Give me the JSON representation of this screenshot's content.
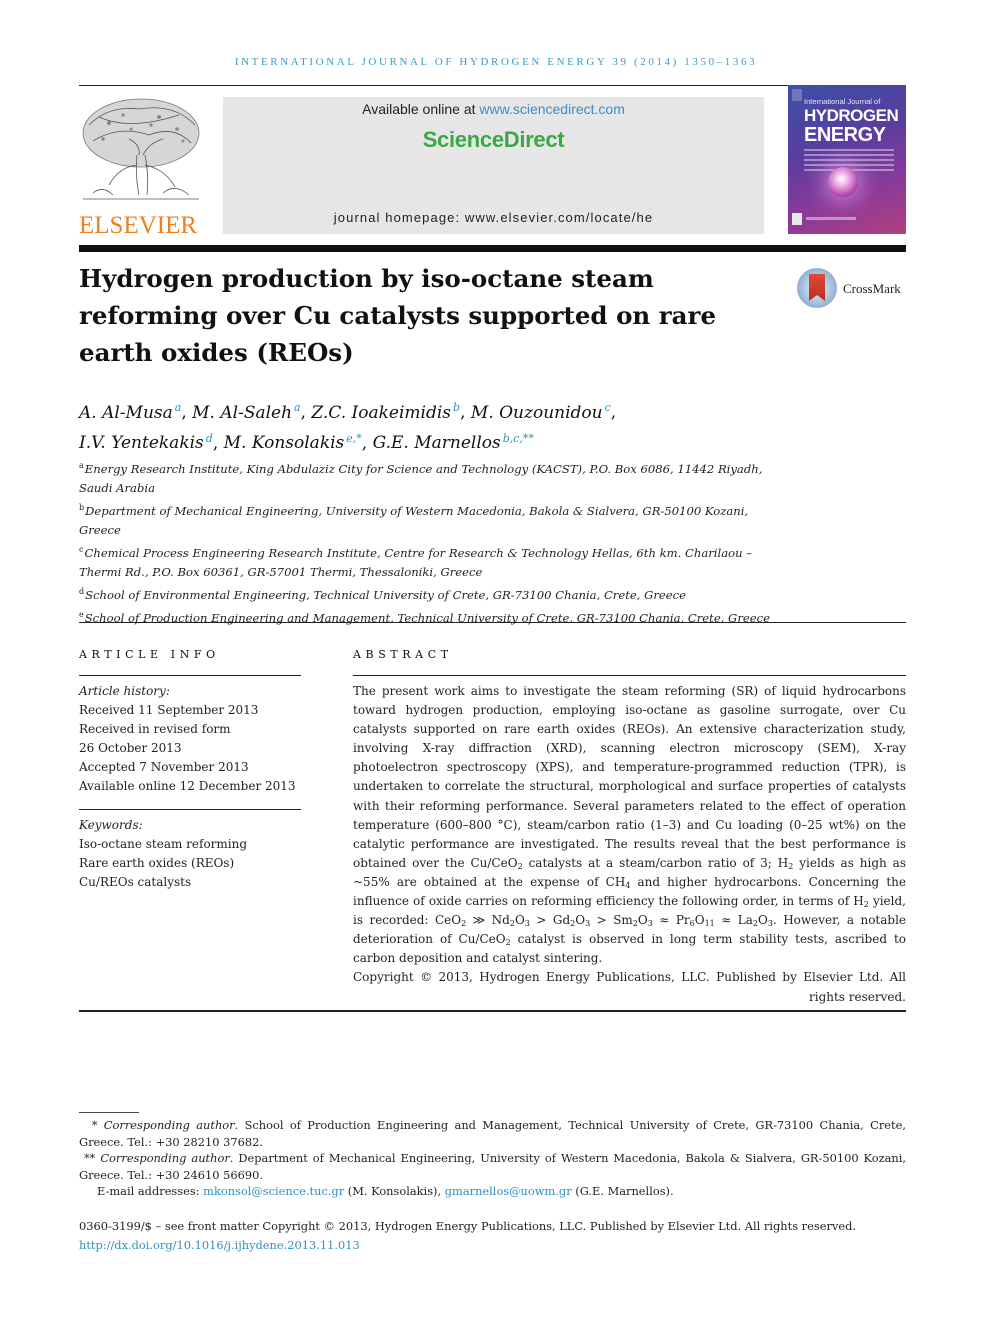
{
  "running_head": "International Journal of Hydrogen Energy 39 (2014) 1350–1363",
  "publisher": {
    "logo_icon": "elsevier-tree-icon",
    "name": "ELSEVIER"
  },
  "masthead": {
    "available_prefix": "Available online at ",
    "available_link": "www.sciencedirect.com",
    "brand": "ScienceDirect",
    "homepage": "journal homepage: www.elsevier.com/locate/he"
  },
  "cover": {
    "line1": "International Journal of",
    "line2": "HYDROGEN",
    "line3": "ENERGY"
  },
  "article": {
    "title": "Hydrogen production by iso-octane steam reforming over Cu catalysts supported on rare earth oxides (REOs)",
    "crossmark_label": "CrossMark",
    "authors": [
      {
        "name": "A. Al-Musa",
        "aff": "a",
        "sep": ", "
      },
      {
        "name": "M. Al-Saleh",
        "aff": "a",
        "sep": ", "
      },
      {
        "name": "Z.C. Ioakeimidis",
        "aff": "b",
        "sep": ", "
      },
      {
        "name": "M. Ouzounidou",
        "aff": "c",
        "sep": ","
      },
      {
        "name": "I.V. Yentekakis",
        "aff": "d",
        "sep": ", "
      },
      {
        "name": "M. Konsolakis",
        "aff": "e,*",
        "sep": ", "
      },
      {
        "name": "G.E. Marnellos",
        "aff": "b,c,**",
        "sep": ""
      }
    ],
    "affiliations": [
      {
        "key": "a",
        "text": "Energy Research Institute, King Abdulaziz City for Science and Technology (KACST), P.O. Box 6086, 11442 Riyadh, Saudi Arabia"
      },
      {
        "key": "b",
        "text": "Department of Mechanical Engineering, University of Western Macedonia, Bakola & Sialvera, GR-50100 Kozani, Greece"
      },
      {
        "key": "c",
        "text": "Chemical Process Engineering Research Institute, Centre for Research & Technology Hellas, 6th km. Charilaou – Thermi Rd., P.O. Box 60361, GR-57001 Thermi, Thessaloniki, Greece"
      },
      {
        "key": "d",
        "text": "School of Environmental Engineering, Technical University of Crete, GR-73100 Chania, Crete, Greece"
      },
      {
        "key": "e",
        "text": "School of Production Engineering and Management, Technical University of Crete, GR-73100 Chania, Crete, Greece"
      }
    ]
  },
  "article_info": {
    "heading": "ARTICLE INFO",
    "history_label": "Article history:",
    "history": [
      "Received 11 September 2013",
      "Received in revised form",
      "26 October 2013",
      "Accepted 7 November 2013",
      "Available online 12 December 2013"
    ],
    "keywords_label": "Keywords:",
    "keywords": [
      "Iso-octane steam reforming",
      "Rare earth oxides (REOs)",
      "Cu/REOs catalysts"
    ]
  },
  "abstract": {
    "heading": "ABSTRACT",
    "p1": "The present work aims to investigate the steam reforming (SR) of liquid hydrocarbons toward hydrogen production, employing iso-octane as gasoline surrogate, over Cu catalysts supported on rare earth oxides (REOs). An extensive characterization study, involving X-ray diffraction (XRD), scanning electron microscopy (SEM), X-ray photoelectron spectroscopy (XPS), and temperature-programmed reduction (TPR), is undertaken to correlate the structural, morphological and surface properties of catalysts with their reforming performance. Several parameters related to the effect of operation temperature (600–800 °C), steam/carbon ratio (1–3) and Cu loading (0–25 wt%) on the catalytic performance are investigated. The results reveal that the best performance is obtained over the Cu/CeO",
    "p1_sub1": "2",
    "p1_b": " catalysts at a steam/carbon ratio of 3; H",
    "p1_sub2": "2",
    "p1_c": " yields as high as ~55% are obtained at the expense of CH",
    "p1_sub3": "4",
    "p1_d": " and higher hydrocarbons. Concerning the influence of oxide carries on reforming efficiency the following order, in terms of H",
    "p1_sub4": "2",
    "p1_e": " yield, is recorded: CeO",
    "order": [
      {
        "t": "2",
        "sub": true
      },
      {
        "t": " ≫ Nd",
        "sub": false
      },
      {
        "t": "2",
        "sub": true
      },
      {
        "t": "O",
        "sub": false
      },
      {
        "t": "3",
        "sub": true
      },
      {
        "t": " > Gd",
        "sub": false
      },
      {
        "t": "2",
        "sub": true
      },
      {
        "t": "O",
        "sub": false
      },
      {
        "t": "3",
        "sub": true
      },
      {
        "t": " > Sm",
        "sub": false
      },
      {
        "t": "2",
        "sub": true
      },
      {
        "t": "O",
        "sub": false
      },
      {
        "t": "3",
        "sub": true
      },
      {
        "t": " ≈ Pr",
        "sub": false
      },
      {
        "t": "6",
        "sub": true
      },
      {
        "t": "O",
        "sub": false
      },
      {
        "t": "11",
        "sub": true
      },
      {
        "t": " ≈ La",
        "sub": false
      },
      {
        "t": "2",
        "sub": true
      },
      {
        "t": "O",
        "sub": false
      },
      {
        "t": "3",
        "sub": true
      },
      {
        "t": ". However, a notable deterioration of Cu/CeO",
        "sub": false
      },
      {
        "t": "2",
        "sub": true
      },
      {
        "t": " catalyst is observed in long term stability tests, ascribed to carbon deposition and catalyst sintering.",
        "sub": false
      }
    ],
    "copyright": "Copyright © 2013, Hydrogen Energy Publications, LLC. Published by Elsevier Ltd. All rights reserved."
  },
  "footnotes": {
    "fn1_mark": "* ",
    "fn1_label": "Corresponding author",
    "fn1_text": ". School of Production Engineering and Management, Technical University of Crete, GR-73100 Chania, Crete, Greece. Tel.: +30 28210 37682.",
    "fn2_mark": "** ",
    "fn2_label": "Corresponding author",
    "fn2_text": ". Department of Mechanical Engineering, University of Western Macedonia, Bakola & Sialvera, GR-50100 Kozani, Greece. Tel.: +30 24610 56690.",
    "email_label": "E-mail addresses: ",
    "email1": "mkonsol@science.tuc.gr",
    "email1_owner": " (M. Konsolakis), ",
    "email2": "gmarnellos@uowm.gr",
    "email2_owner": " (G.E. Marnellos)."
  },
  "front_matter": {
    "line": "0360-3199/$ – see front matter Copyright © 2013, Hydrogen Energy Publications, LLC. Published by Elsevier Ltd. All rights reserved.",
    "doi": "http://dx.doi.org/10.1016/j.ijhydene.2013.11.013"
  },
  "colors": {
    "link": "#2e8fc2",
    "elsevier_orange": "#f07f1c",
    "sciencedirect_green": "#3aa845",
    "masthead_gray": "#e6e6e6"
  }
}
